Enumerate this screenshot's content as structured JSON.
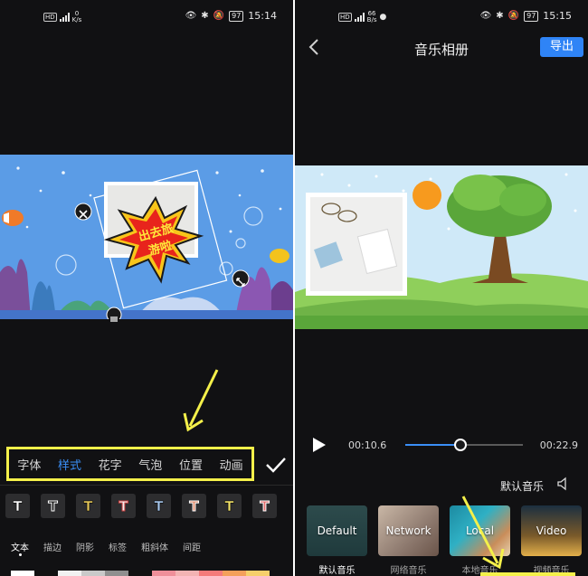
{
  "left": {
    "status": {
      "speed_value": "0",
      "speed_unit": "K/s",
      "battery": "97",
      "time": "15:14"
    },
    "sticker_text": "出去旅游啦",
    "tabs": [
      {
        "label": "字体",
        "active": false
      },
      {
        "label": "样式",
        "active": true
      },
      {
        "label": "花字",
        "active": false
      },
      {
        "label": "气泡",
        "active": false
      },
      {
        "label": "位置",
        "active": false
      },
      {
        "label": "动画",
        "active": false
      }
    ],
    "styles": [
      {
        "glyph": "T",
        "color": "#ffffff"
      },
      {
        "glyph": "T",
        "color": "#111111"
      },
      {
        "glyph": "T",
        "color": "#e7c95a"
      },
      {
        "glyph": "T",
        "color": "#f0f0f0"
      },
      {
        "glyph": "T",
        "color": "#a8c8ee"
      },
      {
        "glyph": "T",
        "color": "#e08a6a"
      },
      {
        "glyph": "T",
        "color": "#f3e36a"
      },
      {
        "glyph": "T",
        "color": "#e46b6b"
      }
    ],
    "sub_tabs": [
      {
        "label": "文本",
        "active": true
      },
      {
        "label": "描边",
        "active": false
      },
      {
        "label": "阴影",
        "active": false
      },
      {
        "label": "标签",
        "active": false
      },
      {
        "label": "粗斜体",
        "active": false
      },
      {
        "label": "间距",
        "active": false
      }
    ],
    "palette": [
      "#ffffff",
      "#111111",
      "#f1f1f1",
      "#c9c9c9",
      "#8f8f8f",
      "#111111",
      "#ef8f9a",
      "#f3b3b3",
      "#f57a7a",
      "#f4a05a",
      "#f6cf6a"
    ]
  },
  "right": {
    "status": {
      "speed_value": "66",
      "speed_unit": "B/s",
      "battery": "97",
      "time": "15:15"
    },
    "title": "音乐相册",
    "export_label": "导出",
    "current_time": "00:10.6",
    "total_time": "00:22.9",
    "progress": 0.47,
    "music_name": "默认音乐",
    "categories": [
      {
        "thumb_text": "Default",
        "label": "默认音乐",
        "selected": true
      },
      {
        "thumb_text": "Network",
        "label": "网络音乐",
        "selected": false
      },
      {
        "thumb_text": "Local",
        "label": "本地音乐",
        "selected": false
      },
      {
        "thumb_text": "Video",
        "label": "视频音乐",
        "selected": false
      }
    ]
  },
  "accent": "#3a8ef6",
  "highlight": "#f4f04a"
}
